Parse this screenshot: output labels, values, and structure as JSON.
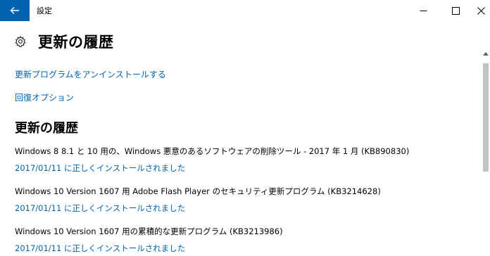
{
  "window": {
    "app_title": "設定"
  },
  "page": {
    "title": "更新の履歴",
    "uninstall_link": "更新プログラムをアンインストールする",
    "recovery_link": "回復オプション",
    "section_title": "更新の履歴"
  },
  "updates": [
    {
      "name": "Windows 8 8.1 と 10 用の、Windows 悪意のあるソフトウェアの削除ツール - 2017 年 1 月 (KB890830)",
      "status": "2017/01/11 に正しくインストールされました"
    },
    {
      "name": "Windows 10 Version 1607 用 Adobe Flash Player のセキュリティ更新プログラム (KB3214628)",
      "status": "2017/01/11 に正しくインストールされました"
    },
    {
      "name": "Windows 10 Version 1607 用の累積的な更新プログラム (KB3213986)",
      "status": "2017/01/11 に正しくインストールされました"
    }
  ],
  "icons": {
    "back": "back-arrow-icon",
    "minimize": "minimize-icon",
    "maximize": "maximize-icon",
    "close": "close-icon",
    "settings": "gear-icon",
    "scroll_up": "chevron-up-icon"
  },
  "colors": {
    "accent": "#0063b1",
    "title_text": "#000000",
    "scroll_thumb": "#c2c2c2"
  }
}
